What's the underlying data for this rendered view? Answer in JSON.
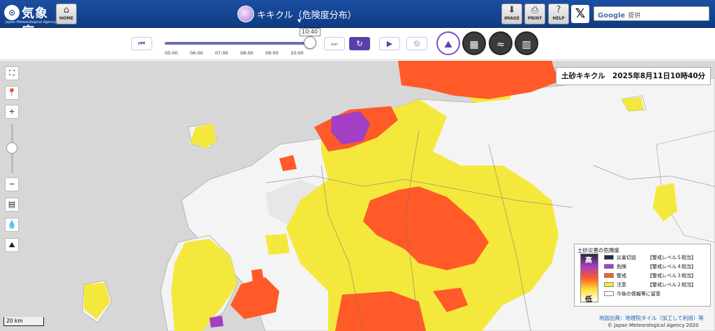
{
  "header": {
    "logo_mark": "⊙",
    "logo_name": "気象庁",
    "logo_en": "Japan Meteorological Agency",
    "home_label": "HOME",
    "title": "キキクル（危険度分布）",
    "buttons": {
      "image": "IMAGE",
      "print": "PRINT",
      "help": "HELP"
    },
    "x_icon": "𝕏",
    "search_brand": "Google",
    "search_placeholder": "提供"
  },
  "toolbar": {
    "current_time": "10:40",
    "ticks": [
      "05:00",
      "06:00",
      "07:00",
      "08:00",
      "09:00",
      "10:00"
    ],
    "progress": 0.97,
    "icons": {
      "first": "⏮",
      "last": "⏭",
      "reload": "↻",
      "play": "▶",
      "speed": "⏲"
    },
    "layer_icons": [
      "kikikuru-landslide-icon",
      "flood-icon",
      "inundation-icon",
      "map-icon"
    ]
  },
  "map": {
    "title": "土砂キキクル　2025年8月11日10時40分",
    "scale": "20 km",
    "attribution": "地図出典：地理院タイル（加工して利用）等",
    "copyright": "© Japan Meteorological Agency 2020",
    "controls": {
      "fullscreen_icon": "⛶",
      "location_icon": "📍",
      "zoom_in": "+",
      "zoom_out": "−",
      "layers_icon": "▤",
      "water_icon": "💧",
      "terrain_icon": "⛰"
    },
    "legend": {
      "title": "土砂災害の危険度",
      "high": "高",
      "low": "低",
      "items": [
        {
          "name": "災害切迫",
          "level": "【警戒レベル５相当】",
          "color": "#2d2440"
        },
        {
          "name": "危険",
          "level": "【警戒レベル４相当】",
          "color": "#a23fc4"
        },
        {
          "name": "警戒",
          "level": "【警戒レベル３相当】",
          "color": "#ff5a28"
        },
        {
          "name": "注意",
          "level": "【警戒レベル２相当】",
          "color": "#f5e83c"
        },
        {
          "name": "今後の情報等に留意",
          "level": "",
          "color": "#ffffff"
        }
      ]
    }
  },
  "colors": {
    "header_blue": "#1b4fa3",
    "sea": "#d7d7d7",
    "land": "#f4f4f4",
    "yellow": "#f5e83c",
    "red": "#ff5a28",
    "purple": "#a23fc4"
  }
}
